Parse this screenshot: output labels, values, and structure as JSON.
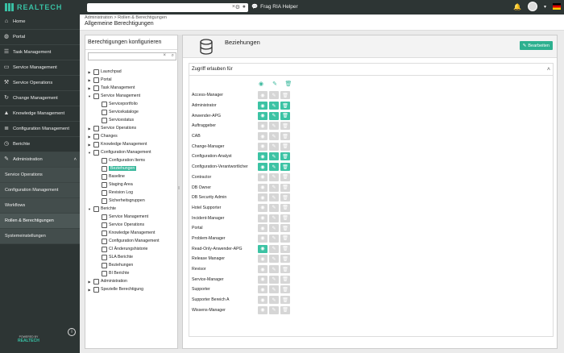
{
  "topbar": {
    "logo_text": "REALTECH",
    "helper_label": "Frag RIA Helper",
    "search_clear": "×",
    "search_settings": "⚙",
    "search_mic": "🎙"
  },
  "sidebar": {
    "items": [
      {
        "label": "Home",
        "icon": "home-icon"
      },
      {
        "label": "Portal",
        "icon": "globe-icon"
      },
      {
        "label": "Task Management",
        "icon": "checklist-icon"
      },
      {
        "label": "Service Management",
        "icon": "monitor-icon"
      },
      {
        "label": "Service Operations",
        "icon": "operations-icon"
      },
      {
        "label": "Change Management",
        "icon": "refresh-icon"
      },
      {
        "label": "Knowledge Management",
        "icon": "graduation-cap-icon"
      },
      {
        "label": "Configuration Management",
        "icon": "stack-icon"
      },
      {
        "label": "Berichte",
        "icon": "clock-icon"
      },
      {
        "label": "Administration",
        "icon": "wrench-icon"
      }
    ],
    "sub_items": [
      {
        "label": "Service Operations"
      },
      {
        "label": "Configuration Management"
      },
      {
        "label": "Workflows"
      },
      {
        "label": "Rollen & Berechtigungen"
      },
      {
        "label": "Systemeinstellungen"
      }
    ],
    "powered_by": "POWERED BY",
    "powered_brand": "REALTECH"
  },
  "header": {
    "breadcrumb": "Administration > Rollen & Berechtigungen",
    "title": "Allgemeine Berechtigungen"
  },
  "tree": {
    "title": "Berechtigungen konfigurieren",
    "search_clear": "×",
    "search_icon": "⌕",
    "nodes": [
      {
        "label": "Launchpad",
        "level": 0,
        "arrow": "▶"
      },
      {
        "label": "Portal",
        "level": 0,
        "arrow": "▶"
      },
      {
        "label": "Task Management",
        "level": 0,
        "arrow": "▶"
      },
      {
        "label": "Service Management",
        "level": 0,
        "arrow": "▼"
      },
      {
        "label": "Serviceportfolio",
        "level": 1,
        "arrow": ""
      },
      {
        "label": "Servicekataloge",
        "level": 1,
        "arrow": ""
      },
      {
        "label": "Servicestatus",
        "level": 1,
        "arrow": ""
      },
      {
        "label": "Service Operations",
        "level": 0,
        "arrow": "▶"
      },
      {
        "label": "Changes",
        "level": 0,
        "arrow": "▶"
      },
      {
        "label": "Knowledge Management",
        "level": 0,
        "arrow": "▶"
      },
      {
        "label": "Configuration Management",
        "level": 0,
        "arrow": "▼"
      },
      {
        "label": "Configuration Items",
        "level": 1,
        "arrow": ""
      },
      {
        "label": "Beziehungen",
        "level": 1,
        "arrow": "",
        "selected": true
      },
      {
        "label": "Baseline",
        "level": 1,
        "arrow": ""
      },
      {
        "label": "Staging Area",
        "level": 1,
        "arrow": ""
      },
      {
        "label": "Revision Log",
        "level": 1,
        "arrow": ""
      },
      {
        "label": "Sicherheitsgruppen",
        "level": 1,
        "arrow": ""
      },
      {
        "label": "Berichte",
        "level": 0,
        "arrow": "▼"
      },
      {
        "label": "Service Management",
        "level": 1,
        "arrow": ""
      },
      {
        "label": "Service Operations",
        "level": 1,
        "arrow": ""
      },
      {
        "label": "Knowledge Management",
        "level": 1,
        "arrow": ""
      },
      {
        "label": "Configuration Management",
        "level": 1,
        "arrow": ""
      },
      {
        "label": "CI Änderungshistorie",
        "level": 1,
        "arrow": ""
      },
      {
        "label": "SLA Berichte",
        "level": 1,
        "arrow": ""
      },
      {
        "label": "Beziehungen",
        "level": 1,
        "arrow": ""
      },
      {
        "label": "BI Berichte",
        "level": 1,
        "arrow": ""
      },
      {
        "label": "Administration",
        "level": 0,
        "arrow": "▶"
      },
      {
        "label": "Spezielle Berechtigung",
        "level": 0,
        "arrow": "▶"
      }
    ]
  },
  "main": {
    "title": "Beziehungen",
    "edit_label": "Bearbeiten",
    "access_label": "Zugriff erlauben für",
    "colors": {
      "accent": "#3cc3a4",
      "disabled": "#d6d6d6"
    },
    "roles": [
      {
        "name": "Access-Manager",
        "view": false,
        "edit": false,
        "del": false
      },
      {
        "name": "Administrator",
        "view": true,
        "edit": true,
        "del": true
      },
      {
        "name": "Anwender-APG",
        "view": true,
        "edit": true,
        "del": true
      },
      {
        "name": "Auftraggeber",
        "view": false,
        "edit": false,
        "del": false
      },
      {
        "name": "CAB",
        "view": false,
        "edit": false,
        "del": false
      },
      {
        "name": "Change-Manager",
        "view": false,
        "edit": false,
        "del": false
      },
      {
        "name": "Configuration-Analyst",
        "view": true,
        "edit": true,
        "del": true
      },
      {
        "name": "Configuration-Verantwortlicher",
        "view": true,
        "edit": true,
        "del": true
      },
      {
        "name": "Contractor",
        "view": false,
        "edit": false,
        "del": false
      },
      {
        "name": "DB Owner",
        "view": false,
        "edit": false,
        "del": false
      },
      {
        "name": "DB Security Admin",
        "view": false,
        "edit": false,
        "del": false
      },
      {
        "name": "Hotel Supporter",
        "view": false,
        "edit": false,
        "del": false
      },
      {
        "name": "Incident-Manager",
        "view": false,
        "edit": false,
        "del": false
      },
      {
        "name": "Portal",
        "view": false,
        "edit": false,
        "del": false
      },
      {
        "name": "Problem-Manager",
        "view": false,
        "edit": false,
        "del": false
      },
      {
        "name": "Read-Only-Anwender-APG",
        "view": true,
        "edit": false,
        "del": false
      },
      {
        "name": "Release Manager",
        "view": false,
        "edit": false,
        "del": false
      },
      {
        "name": "Revisor",
        "view": false,
        "edit": false,
        "del": false
      },
      {
        "name": "Service-Manager",
        "view": false,
        "edit": false,
        "del": false
      },
      {
        "name": "Supporter",
        "view": false,
        "edit": false,
        "del": false
      },
      {
        "name": "Supporter Bereich A",
        "view": false,
        "edit": false,
        "del": false
      },
      {
        "name": "Wissens-Manager",
        "view": false,
        "edit": false,
        "del": false
      }
    ]
  }
}
